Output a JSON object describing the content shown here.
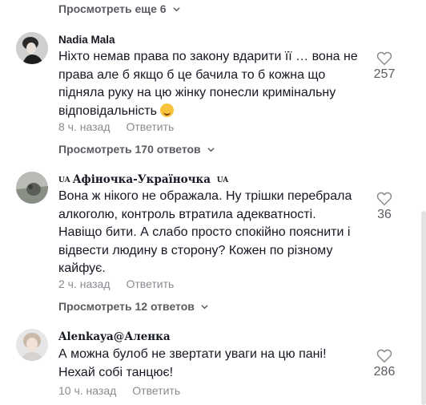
{
  "top_more": {
    "label": "Просмотреть еще 6"
  },
  "comments": [
    {
      "username": "Nadia Mala",
      "text": "Ніхто немав права по закону вдарити її … вона не права але б якщо б це бачила то б кожна що підняла руку на цю жінку понесли кримінальну відповідальність",
      "emoji": "smiling-face-emoji",
      "time": "8 ч. назад",
      "reply": "Ответить",
      "likes": "257",
      "replies_toggle": "Просмотреть 170 ответов"
    },
    {
      "username": "Афіночка-Україночка",
      "flag_left": "UA",
      "flag_right": "UA",
      "text": "Вона ж нікого не ображала. Ну трішки перебрала алкоголю, контроль втратила адекватності. Навіщо бити. А слабо просто спокійно пояснити і відвести людину в сторону? Кожен по різному кайфує.",
      "time": "2 ч. назад",
      "reply": "Ответить",
      "likes": "36",
      "replies_toggle": "Просмотреть 12 ответов"
    },
    {
      "username": "Alenkaya@Аленка",
      "text": "А можна булоб не звертати уваги на цю пані! Нехай собі танцює!",
      "time": "10 ч. назад",
      "reply": "Ответить",
      "likes": "286"
    }
  ],
  "colors": {
    "text": "#161823",
    "muted": "#8a8b91",
    "secondary": "#5b5c62"
  },
  "icons": {
    "like": "heart-outline-icon",
    "expand": "chevron-down-icon"
  }
}
